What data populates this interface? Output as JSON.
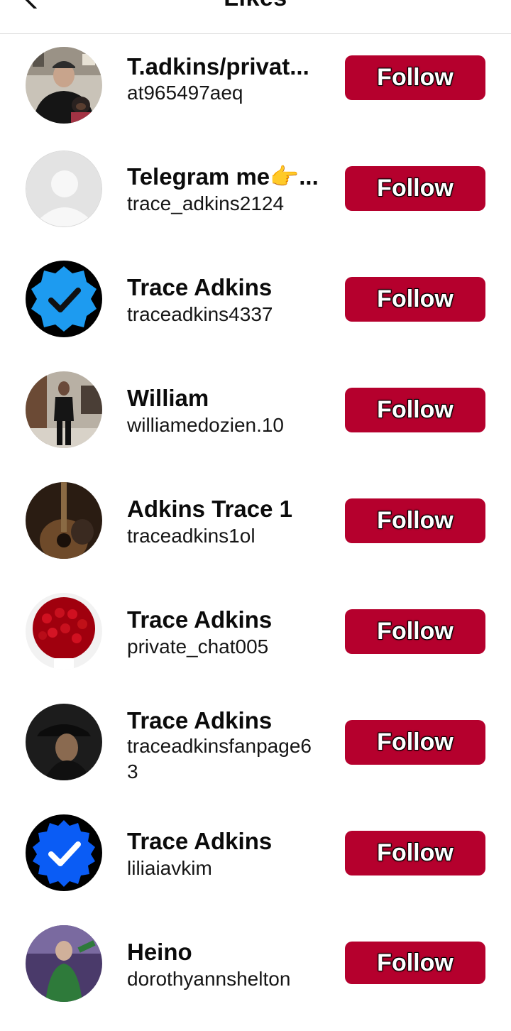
{
  "header": {
    "title": "Likes"
  },
  "follow_label": "Follow",
  "accent_color": "#b5002d",
  "users": [
    {
      "name": "T.adkins/privat...",
      "handle": "at965497aeq",
      "avatar": "photo-man-with-dog"
    },
    {
      "name": "Telegram me👉...",
      "handle": "trace_adkins2124",
      "avatar": "default-avatar-icon"
    },
    {
      "name": "Trace Adkins",
      "handle": "traceadkins4337",
      "avatar": "verified-badge-icon"
    },
    {
      "name": "William",
      "handle": "williamedozien.10",
      "avatar": "photo-man-standing"
    },
    {
      "name": "Adkins Trace 1",
      "handle": "traceadkins1ol",
      "avatar": "photo-guitar"
    },
    {
      "name": "Trace Adkins",
      "handle": "private_chat005",
      "avatar": "photo-red-roses"
    },
    {
      "name": "Trace Adkins",
      "handle": "traceadkinsfanpage63",
      "avatar": "photo-man-in-hat"
    },
    {
      "name": "Trace Adkins",
      "handle": "liliaiavkim",
      "avatar": "verified-badge-icon"
    },
    {
      "name": "Heino",
      "handle": "dorothyannshelton",
      "avatar": "photo-performer"
    }
  ]
}
